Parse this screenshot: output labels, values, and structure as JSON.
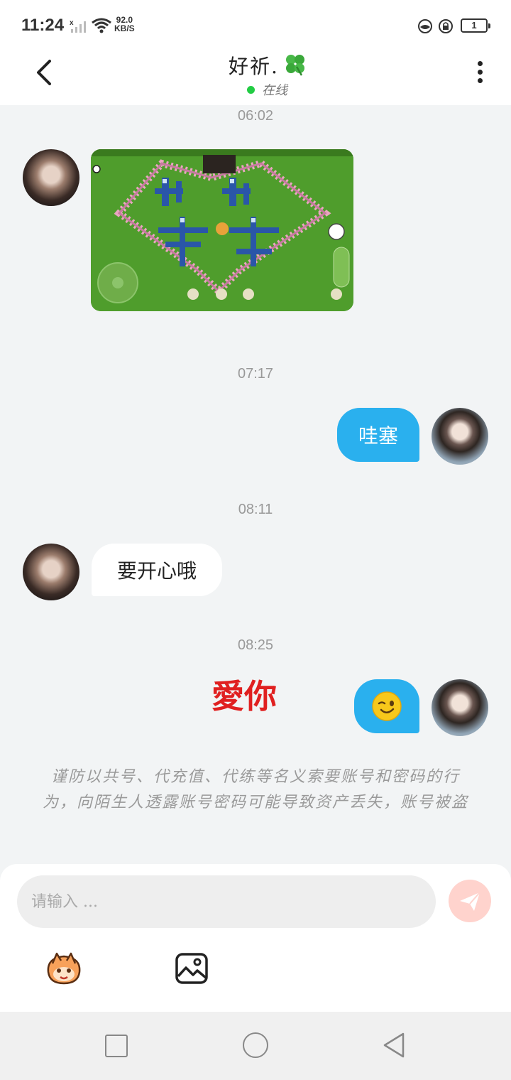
{
  "status_bar": {
    "time": "11:24",
    "speed_value": "92.0",
    "speed_unit": "KB/S",
    "battery": "1"
  },
  "header": {
    "title": "好祈.",
    "title_icon": "clover-icon",
    "status": "在线"
  },
  "messages": [
    {
      "time": "06:02",
      "sender": "other",
      "type": "image",
      "content": "game-screenshot"
    },
    {
      "time": "07:17",
      "sender": "me",
      "type": "text",
      "text": "哇塞"
    },
    {
      "time": "08:11",
      "sender": "other",
      "type": "text",
      "text": "要开心哦"
    },
    {
      "time": "08:25",
      "sender": "me",
      "type": "emoji",
      "emoji": "wink-emoji",
      "caption": "愛你"
    }
  ],
  "notice": "谨防以共号、代充值、代练等名义索要账号和密码的行为，向陌生人透露账号密码可能导致资产丢失，账号被盗",
  "input": {
    "placeholder": "请输入 ..."
  },
  "toolbar": {
    "emoji_icon": "emoji-sticker-icon",
    "image_icon": "image-icon",
    "send_icon": "send-icon"
  },
  "colors": {
    "my_bubble": "#2ab0ee",
    "online_dot": "#22cc44",
    "love_text": "#e02020",
    "send_button": "#ffd3cd"
  }
}
